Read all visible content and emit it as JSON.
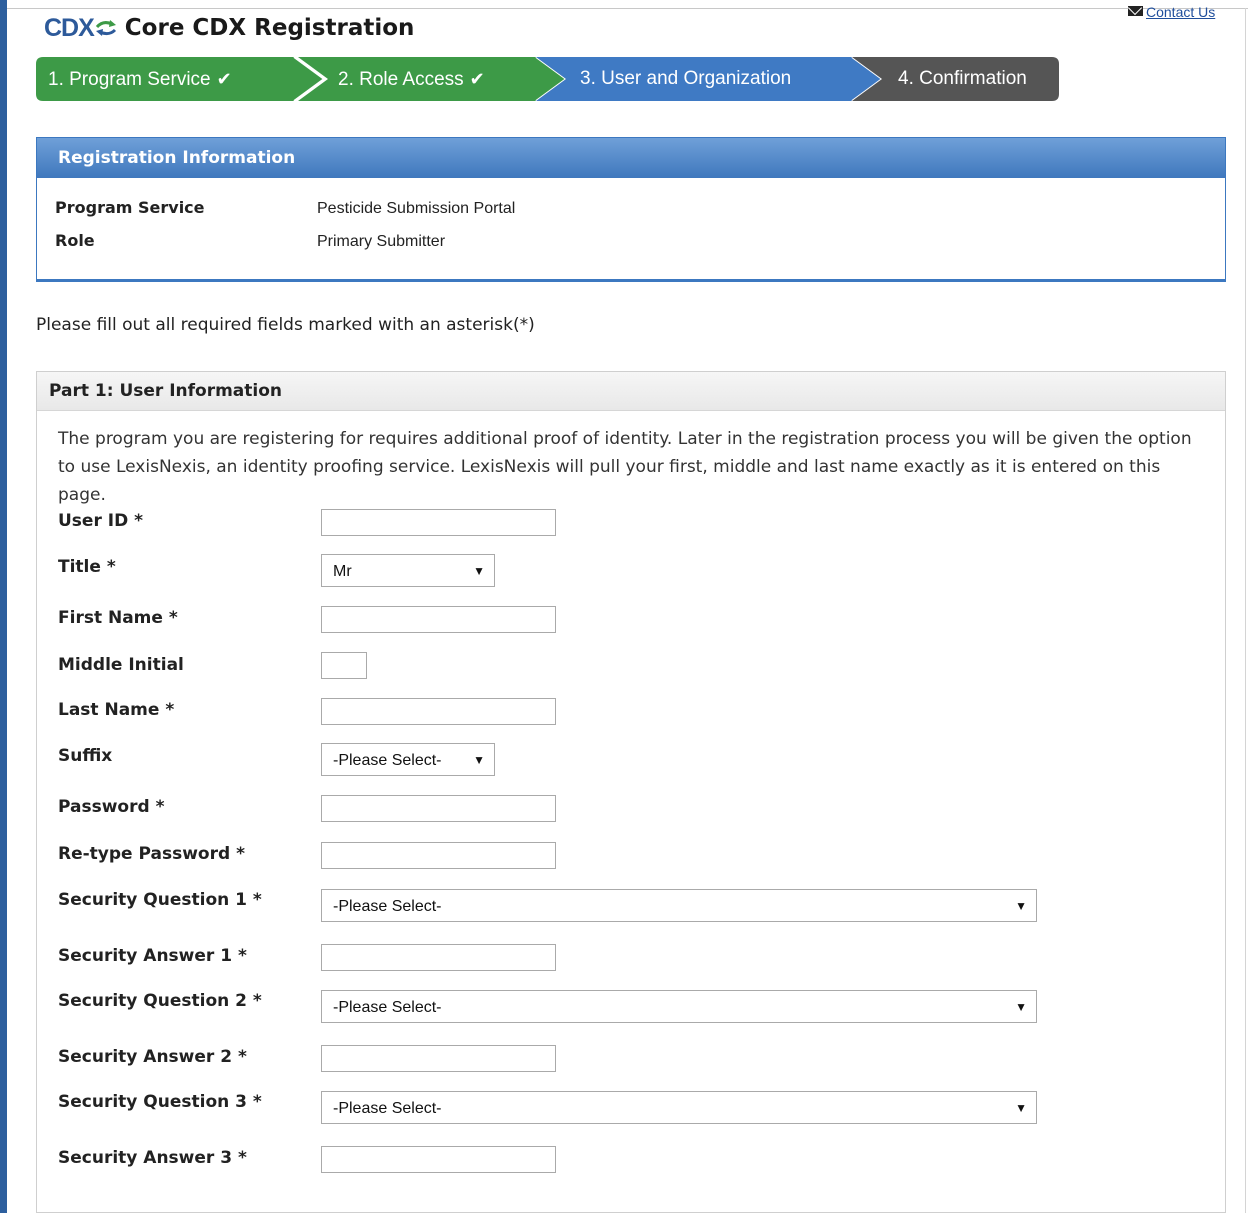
{
  "header": {
    "contact_label": "Contact Us",
    "logo_text": "CDX",
    "title": "Core CDX Registration"
  },
  "steps": [
    {
      "label": "1. Program Service",
      "done": true,
      "color": "#3d9a47"
    },
    {
      "label": "2. Role Access",
      "done": true,
      "color": "#3d9a47"
    },
    {
      "label": "3. User and Organization",
      "done": false,
      "color": "#3f7ac4"
    },
    {
      "label": "4. Confirmation",
      "done": false,
      "color": "#555555"
    }
  ],
  "check_glyph": "✔",
  "registration": {
    "heading": "Registration Information",
    "program_service_label": "Program Service",
    "program_service_value": "Pesticide Submission Portal",
    "role_label": "Role",
    "role_value": "Primary Submitter"
  },
  "instructions": "Please fill out all required fields marked with an asterisk(*)",
  "part1": {
    "heading": "Part 1: User Information",
    "intro": "The program you are registering for requires additional proof of identity. Later in the registration process you will be given the option to use LexisNexis, an identity proofing service. LexisNexis will pull your first, middle and last name exactly as it is entered on this page.",
    "fields": {
      "user_id": {
        "label": "User ID *",
        "value": ""
      },
      "title": {
        "label": "Title *",
        "value": "Mr"
      },
      "first_name": {
        "label": "First Name *",
        "value": ""
      },
      "middle_initial": {
        "label": "Middle Initial",
        "value": ""
      },
      "last_name": {
        "label": "Last Name *",
        "value": ""
      },
      "suffix": {
        "label": "Suffix",
        "value": "-Please Select-"
      },
      "password": {
        "label": "Password *",
        "value": ""
      },
      "retype_password": {
        "label": "Re-type Password *",
        "value": ""
      },
      "security_question_1": {
        "label": "Security Question 1 *",
        "value": "-Please Select-"
      },
      "security_answer_1": {
        "label": "Security Answer 1 *",
        "value": ""
      },
      "security_question_2": {
        "label": "Security Question 2 *",
        "value": "-Please Select-"
      },
      "security_answer_2": {
        "label": "Security Answer 2 *",
        "value": ""
      },
      "security_question_3": {
        "label": "Security Question 3 *",
        "value": "-Please Select-"
      },
      "security_answer_3": {
        "label": "Security Answer 3 *",
        "value": ""
      }
    }
  },
  "dropdown_arrow": "▼"
}
